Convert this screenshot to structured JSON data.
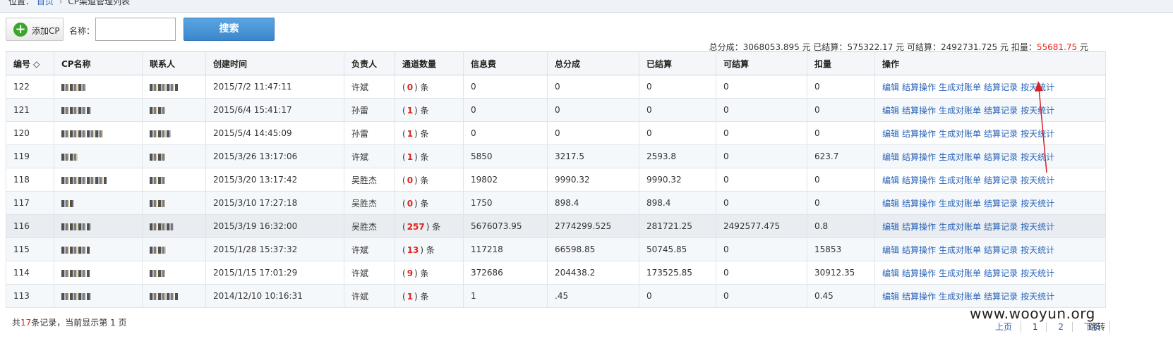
{
  "breadcrumb": {
    "prefix": "位置：",
    "home": "首页",
    "current": "CP渠道管理列表"
  },
  "toolbar": {
    "add_label": "添加CP",
    "name_label": "名称：",
    "search_label": "搜索",
    "name_value": ""
  },
  "summary": {
    "total_share_label": "总分成：",
    "total_share": "3068053.895",
    "unit": "元",
    "settled_label": "已结算：",
    "settled": "575322.17",
    "settleable_label": "可结算：",
    "settleable": "2492731.725",
    "deduct_label": "扣量：",
    "deduct": "55681.75"
  },
  "table": {
    "headers": [
      "编号 ◇",
      "CP名称",
      "联系人",
      "创建时间",
      "负责人",
      "通道数量",
      "信息费",
      "总分成",
      "已结算",
      "可结算",
      "扣量",
      "操作"
    ],
    "ops": [
      "编辑",
      "结算操作",
      "生成对账单",
      "结算记录",
      "按天统计"
    ],
    "rows": [
      {
        "id": "122",
        "time": "2015/7/2 11:47:11",
        "owner": "许斌",
        "channels": "0",
        "fee": "0",
        "share": "0",
        "settled": "0",
        "settleable": "0",
        "deduct": "0"
      },
      {
        "id": "121",
        "time": "2015/6/4 15:41:17",
        "owner": "孙雷",
        "channels": "1",
        "fee": "0",
        "share": "0",
        "settled": "0",
        "settleable": "0",
        "deduct": "0"
      },
      {
        "id": "120",
        "time": "2015/5/4 14:45:09",
        "owner": "孙雷",
        "channels": "1",
        "fee": "0",
        "share": "0",
        "settled": "0",
        "settleable": "0",
        "deduct": "0"
      },
      {
        "id": "119",
        "time": "2015/3/26 13:17:06",
        "owner": "许斌",
        "channels": "1",
        "fee": "5850",
        "share": "3217.5",
        "settled": "2593.8",
        "settleable": "0",
        "deduct": "623.7"
      },
      {
        "id": "118",
        "time": "2015/3/20 13:17:42",
        "owner": "吴胜杰",
        "channels": "0",
        "fee": "19802",
        "share": "9990.32",
        "settled": "9990.32",
        "settleable": "0",
        "deduct": "0"
      },
      {
        "id": "117",
        "time": "2015/3/10 17:27:18",
        "owner": "吴胜杰",
        "channels": "0",
        "fee": "1750",
        "share": "898.4",
        "settled": "898.4",
        "settleable": "0",
        "deduct": "0"
      },
      {
        "id": "116",
        "time": "2015/3/19 16:32:00",
        "owner": "吴胜杰",
        "channels": "257",
        "fee": "5676073.95",
        "share": "2774299.525",
        "settled": "281721.25",
        "settleable": "2492577.475",
        "deduct": "0.8"
      },
      {
        "id": "115",
        "time": "2015/1/28 15:37:32",
        "owner": "许斌",
        "channels": "13",
        "fee": "117218",
        "share": "66598.85",
        "settled": "50745.85",
        "settleable": "0",
        "deduct": "15853"
      },
      {
        "id": "114",
        "time": "2015/1/15 17:01:29",
        "owner": "许斌",
        "channels": "9",
        "fee": "372686",
        "share": "204438.2",
        "settled": "173525.85",
        "settleable": "0",
        "deduct": "30912.35"
      },
      {
        "id": "113",
        "time": "2014/12/10 10:16:31",
        "owner": "许斌",
        "channels": "1",
        "fee": "1",
        "share": ".45",
        "settled": "0",
        "settleable": "0",
        "deduct": "0.45"
      }
    ]
  },
  "footer": {
    "total_prefix": "共",
    "total": "17",
    "total_suffix": "条记录，当前显示第",
    "page": "1",
    "page_suffix": "页"
  },
  "pager": {
    "prev": "上页",
    "p1": "1",
    "p2": "2",
    "next": "下页",
    "jump": "跳转"
  },
  "watermark": "www.wooyun.org",
  "colors": {
    "accent": "#3a86cc",
    "link": "#2a63b8",
    "warn": "#e0241b",
    "annotation": "#d8202a"
  }
}
